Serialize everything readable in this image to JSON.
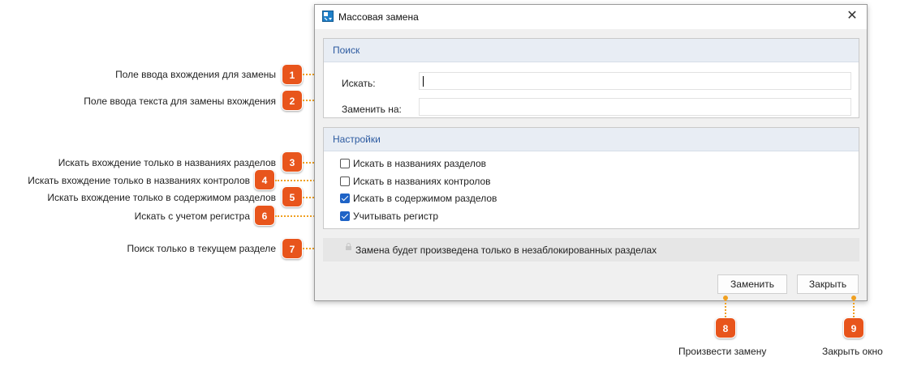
{
  "dialog": {
    "title": "Массовая замена",
    "search_group": {
      "title": "Поиск",
      "find_label": "Искать:",
      "find_value": "",
      "replace_label": "Заменить на:",
      "replace_value": ""
    },
    "settings_group": {
      "title": "Настройки",
      "options": [
        {
          "label": "Искать в названиях разделов",
          "checked": false
        },
        {
          "label": "Искать в названиях контролов",
          "checked": false
        },
        {
          "label": "Искать в содержимом разделов",
          "checked": true
        },
        {
          "label": "Учитывать регистр",
          "checked": true
        }
      ]
    },
    "notice": "Замена будет произведена только в незаблокированных разделах",
    "buttons": {
      "replace": "Заменить",
      "close": "Закрыть"
    }
  },
  "annotations": {
    "left": [
      {
        "number": "1",
        "text": "Поле ввода вхождения для замены"
      },
      {
        "number": "2",
        "text": "Поле ввода текста для замены вхождения"
      },
      {
        "number": "3",
        "text": "Искать вхождение только в названиях разделов"
      },
      {
        "number": "4",
        "text": "Искать вхождение только в названиях контролов"
      },
      {
        "number": "5",
        "text": "Искать вхождение только в содержимом разделов"
      },
      {
        "number": "6",
        "text": "Искать с учетом регистра"
      },
      {
        "number": "7",
        "text": "Поиск только в текущем разделе"
      }
    ],
    "bottom": [
      {
        "number": "8",
        "text": "Произвести замену"
      },
      {
        "number": "9",
        "text": "Закрыть окно"
      }
    ]
  },
  "colors": {
    "badge": "#e8551c",
    "leader": "#f0a020",
    "group_title": "#2c5aa0",
    "checkbox_on": "#1e63c6"
  },
  "icons": {
    "app": "replace-app-icon",
    "close": "close-icon",
    "lock": "lock-icon"
  }
}
